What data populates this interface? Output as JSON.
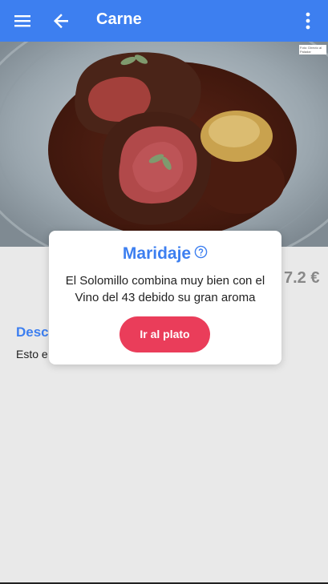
{
  "appbar": {
    "title": "Carne",
    "menu_icon": "menu-icon",
    "back_icon": "arrow-back-icon",
    "more_icon": "more-vert-icon"
  },
  "hero": {
    "image": "steak-on-plate",
    "credit": "Foto: Directo al Paladar"
  },
  "dish": {
    "price": "7.2 €",
    "description_title": "Desc",
    "description_text": "Esto e"
  },
  "dialog": {
    "title": "Maridaje",
    "help_icon": "help-circle-icon",
    "text": "El Solomillo combina muy bien con el Vino del 43 debido su gran aroma",
    "button_label": "Ir al plato"
  },
  "colors": {
    "primary": "#3d7ff0",
    "accent": "#ea3d5a",
    "background": "#e9e9e9"
  }
}
